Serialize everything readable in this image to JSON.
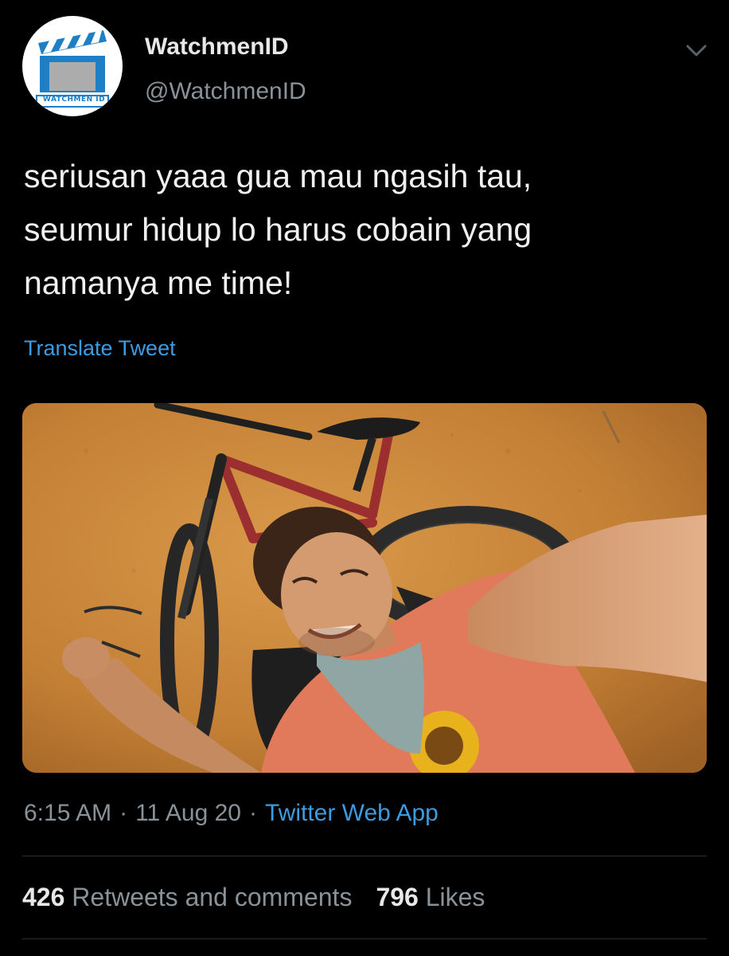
{
  "account": {
    "display_name": "WatchmenID",
    "handle": "@WatchmenID",
    "avatar_logo_text": "WATCHMEN ID"
  },
  "tweet": {
    "text": "seriusan yaaa gua mau ngasih tau,\nseumur hidup lo harus cobain yang\nnamanya me time!",
    "translate_label": "Translate Tweet",
    "media": {
      "description_icon": "photo-image"
    }
  },
  "meta": {
    "time": "6:15 AM",
    "separator": "·",
    "date": "11 Aug 20",
    "source": "Twitter Web App"
  },
  "stats": {
    "retweets_count": "426",
    "retweets_label": "Retweets and comments",
    "likes_count": "796",
    "likes_label": "Likes"
  },
  "colors": {
    "background": "#000000",
    "link": "#3d9be0",
    "secondary_text": "#8a9299",
    "primary_text": "#e8e8e8"
  }
}
